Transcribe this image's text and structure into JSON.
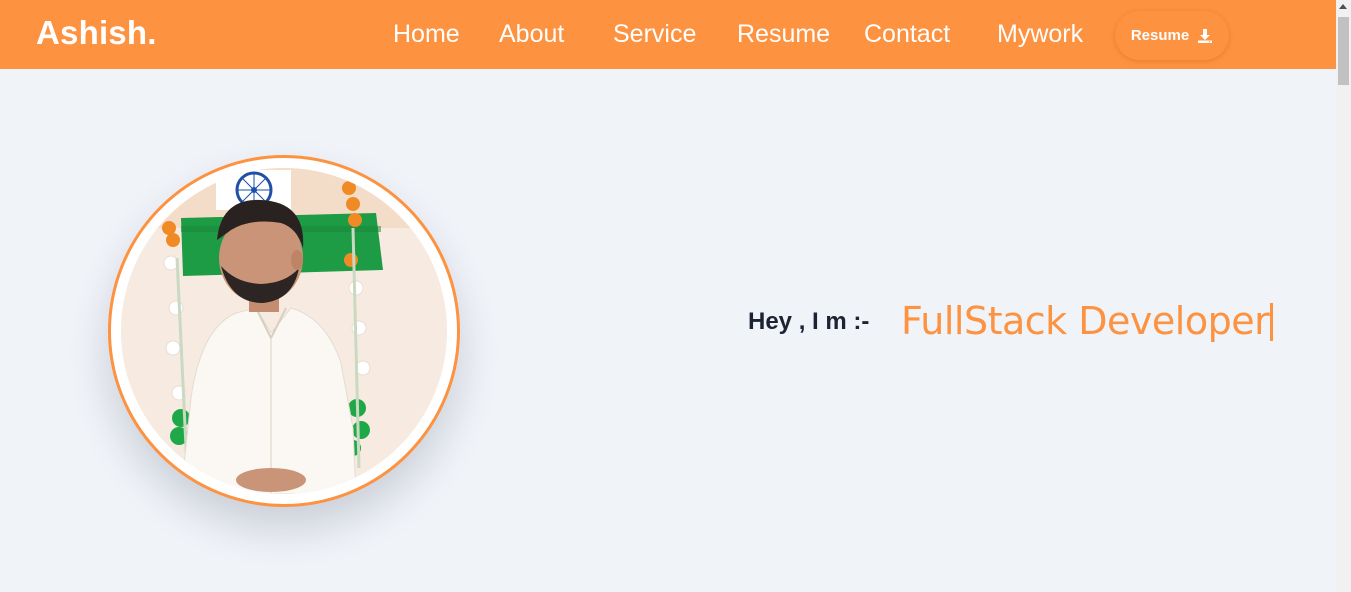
{
  "navbar": {
    "brand": "Ashish.",
    "links": [
      "Home",
      "About",
      "Service",
      "Resume",
      "Contact",
      "Mywork"
    ],
    "resume_button": "Resume",
    "resume_icon": "download-icon",
    "background_color": "#fd9240"
  },
  "hero": {
    "intro": "Hey , I m :-",
    "typed_text": "FullStack Developer",
    "accent_color": "#fd9240"
  }
}
